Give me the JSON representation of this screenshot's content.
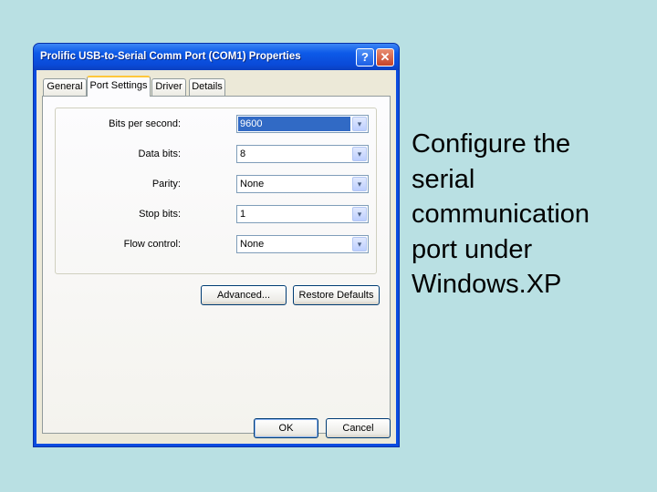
{
  "dialog": {
    "title": "Prolific USB-to-Serial Comm Port (COM1) Properties",
    "help_label": "?",
    "close_label": "✕"
  },
  "tabs": [
    {
      "label": "General"
    },
    {
      "label": "Port Settings",
      "active": true
    },
    {
      "label": "Driver"
    },
    {
      "label": "Details"
    }
  ],
  "fields": {
    "bits_per_second": {
      "label": "Bits per second:",
      "value": "9600",
      "arrow": "▾"
    },
    "data_bits": {
      "label": "Data bits:",
      "value": "8",
      "arrow": "▾"
    },
    "parity": {
      "label": "Parity:",
      "value": "None",
      "arrow": "▾"
    },
    "stop_bits": {
      "label": "Stop bits:",
      "value": "1",
      "arrow": "▾"
    },
    "flow_control": {
      "label": "Flow control:",
      "value": "None",
      "arrow": "▾"
    }
  },
  "buttons": {
    "advanced": "Advanced...",
    "restore_defaults": "Restore Defaults",
    "ok": "OK",
    "cancel": "Cancel"
  },
  "caption": {
    "lines": [
      "Configure the",
      "serial",
      "communication",
      "port under",
      "Windows.XP"
    ]
  },
  "colors": {
    "background": "#b9e0e3",
    "titlebar": "#0a4ce0",
    "selection": "#316ac5"
  }
}
